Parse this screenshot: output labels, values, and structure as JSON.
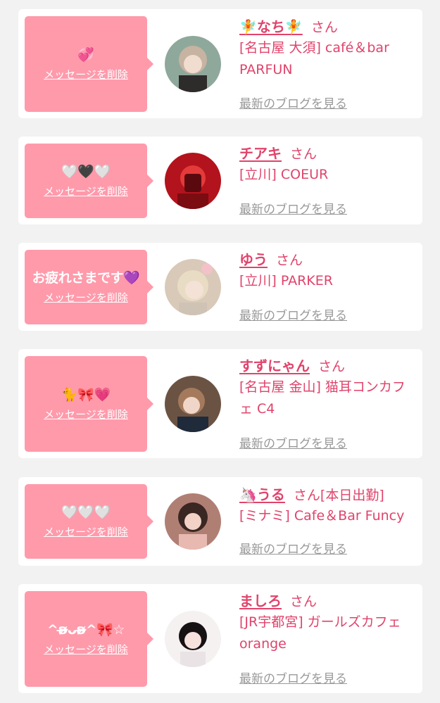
{
  "entries": [
    {
      "message": "💞",
      "delete_label": "メッセージを削除",
      "name": "🧚なち🧚",
      "honorific": "さん",
      "shop": "[名古屋 大須] café＆bar PARFUN",
      "blog_label": "最新のブログを見る"
    },
    {
      "message": "🤍🖤🤍",
      "delete_label": "メッセージを削除",
      "name": "チアキ",
      "honorific": "さん",
      "shop": "[立川] COEUR",
      "blog_label": "最新のブログを見る"
    },
    {
      "message": "お疲れさまです💜",
      "delete_label": "メッセージを削除",
      "name": "ゆう",
      "honorific": "さん",
      "shop": "[立川] PARKER",
      "blog_label": "最新のブログを見る"
    },
    {
      "message": "🐈🎀💗",
      "delete_label": "メッセージを削除",
      "name": "すずにゃん",
      "honorific": "さん",
      "shop": "[名古屋 金山] 猫耳コンカフェ C4",
      "blog_label": "最新のブログを見る"
    },
    {
      "message": "🤍🤍🤍",
      "delete_label": "メッセージを削除",
      "name": "🦄うる",
      "honorific": "さん[本日出勤]",
      "shop": "[ミナミ] Cafe＆Bar Funcy",
      "blog_label": "最新のブログを見る"
    },
    {
      "message": "^ʚ̴̶̷ᴗʚ̴̶̷^🎀☆",
      "delete_label": "メッセージを削除",
      "name": "ましろ",
      "honorific": "さん",
      "shop": "[JR宇都宮] ガールズカフェ orange",
      "blog_label": "最新のブログを見る"
    }
  ],
  "colors": {
    "page_background": "#f2f2f2",
    "card_background": "#ffffff",
    "bubble": "#ff9aab",
    "accent_text": "#e0436b",
    "link_gray": "#999999"
  }
}
